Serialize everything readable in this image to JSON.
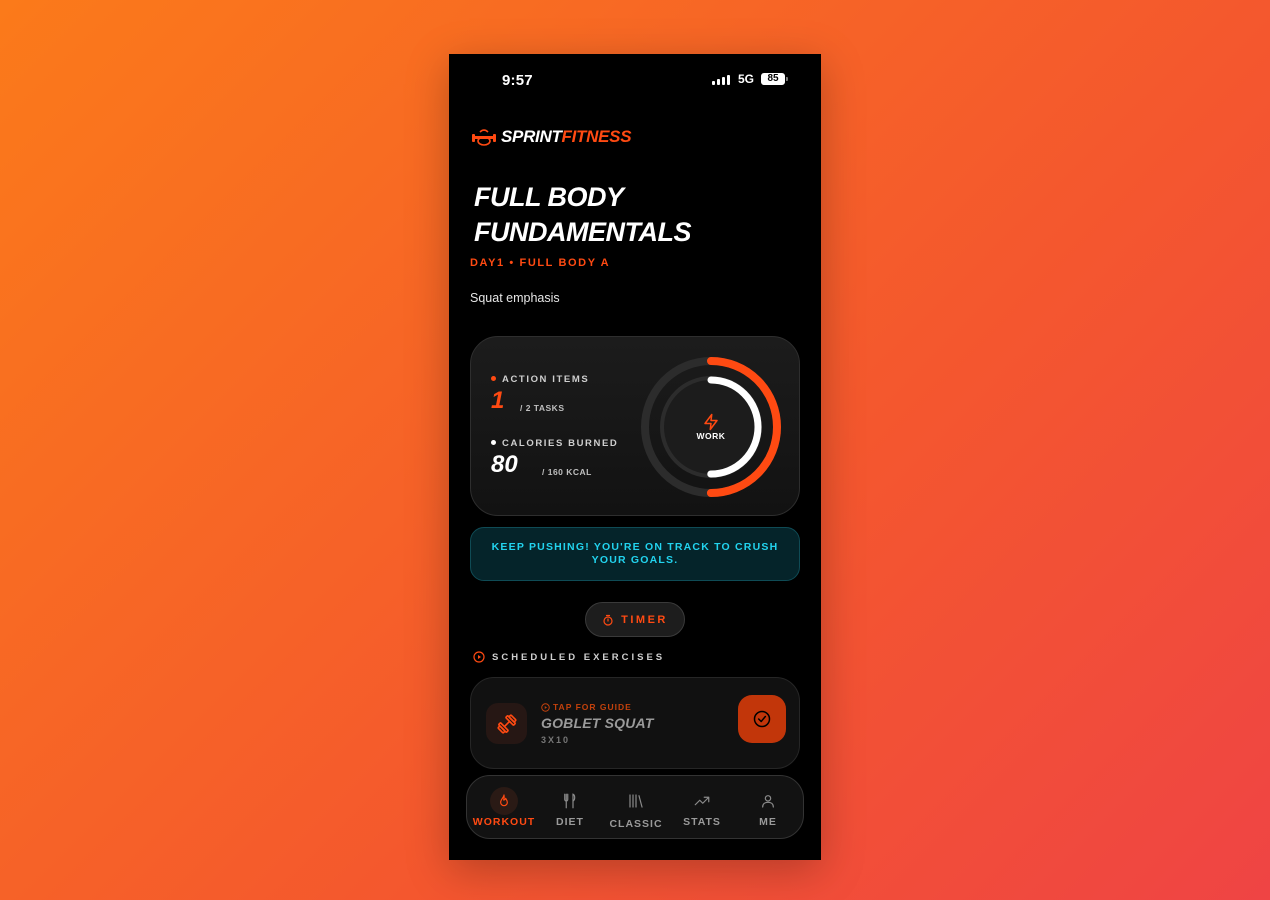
{
  "status_bar": {
    "time": "9:57",
    "network": "5G",
    "battery": "85"
  },
  "brand": {
    "part1": "SPRINT",
    "part2": "FITNESS"
  },
  "workout": {
    "title_line1": "FULL BODY",
    "title_line2": "FUNDAMENTALS",
    "subtitle": "DAY1 • FULL BODY A",
    "description": "Squat emphasis"
  },
  "stats": {
    "action_items_label": "ACTION ITEMS",
    "action_items_value": "1",
    "action_items_total": "/ 2 TASKS",
    "calories_label": "CALORIES BURNED",
    "calories_value": "80",
    "calories_total": "/ 160 KCAL",
    "ring_label": "WORK",
    "outer_ring_progress": 0.5,
    "inner_ring_progress": 0.5
  },
  "motivation": "KEEP PUSHING! YOU'RE ON TRACK TO CRUSH YOUR GOALS.",
  "timer_label": "TIMER",
  "section_title": "SCHEDULED EXERCISES",
  "exercise": {
    "guide": "TAP FOR GUIDE",
    "name": "GOBLET SQUAT",
    "sets": "3X10"
  },
  "nav": [
    {
      "label": "WORKOUT",
      "icon": "flame-icon",
      "active": true
    },
    {
      "label": "DIET",
      "icon": "utensils-icon",
      "active": false
    },
    {
      "label": "CLASSIC",
      "icon": "library-icon",
      "active": false
    },
    {
      "label": "STATS",
      "icon": "trending-up-icon",
      "active": false
    },
    {
      "label": "ME",
      "icon": "user-icon",
      "active": false
    }
  ],
  "colors": {
    "accent": "#ff4a12",
    "cyan": "#22d3ee",
    "background": "#000000"
  }
}
